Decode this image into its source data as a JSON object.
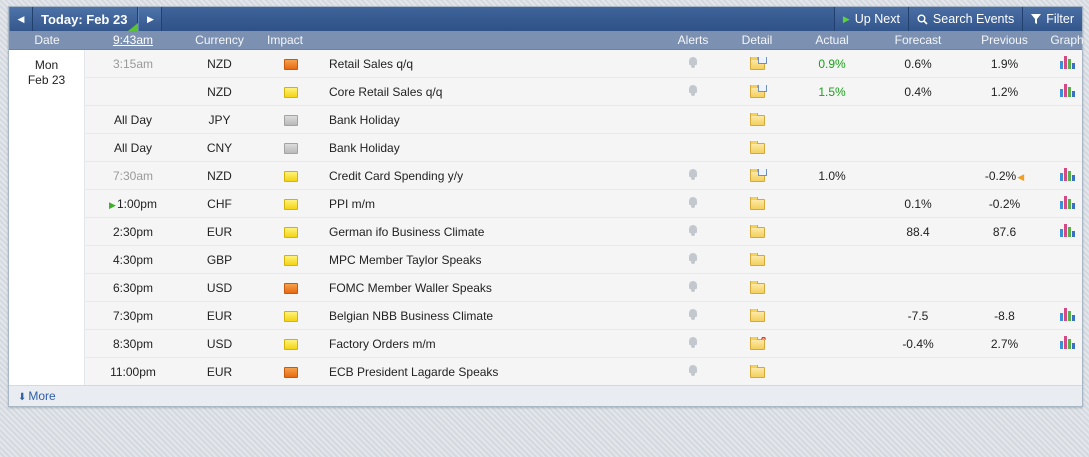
{
  "toolbar": {
    "prev_icon": "◀",
    "next_icon": "▶",
    "today_label": "Today: Feb 23",
    "up_next_label": "Up Next",
    "search_label": "Search Events",
    "filter_label": "Filter"
  },
  "headers": {
    "date": "Date",
    "time": "9:43am",
    "currency": "Currency",
    "impact": "Impact",
    "alerts": "Alerts",
    "detail": "Detail",
    "actual": "Actual",
    "forecast": "Forecast",
    "previous": "Previous",
    "graph": "Graph"
  },
  "day": {
    "weekday": "Mon",
    "date": "Feb 23"
  },
  "colors": {
    "high_impact": "#e56a12",
    "medium_impact": "#f3d312",
    "holiday": "#b9b9b9",
    "better_actual": "#19a319"
  },
  "events": [
    {
      "time": "3:15am",
      "past": true,
      "currency": "NZD",
      "impact": "high",
      "event": "Retail Sales q/q",
      "alert": true,
      "detail": "doc",
      "actual": "0.9%",
      "actual_better": true,
      "forecast": "0.6%",
      "previous": "1.9%",
      "revised": false,
      "graph": true,
      "next": false
    },
    {
      "time": "",
      "past": true,
      "currency": "NZD",
      "impact": "medium",
      "event": "Core Retail Sales q/q",
      "alert": true,
      "detail": "doc",
      "actual": "1.5%",
      "actual_better": true,
      "forecast": "0.4%",
      "previous": "1.2%",
      "revised": false,
      "graph": true,
      "next": false
    },
    {
      "time": "All Day",
      "past": false,
      "currency": "JPY",
      "impact": "holiday",
      "event": "Bank Holiday",
      "alert": false,
      "detail": "folder",
      "actual": "",
      "actual_better": false,
      "forecast": "",
      "previous": "",
      "revised": false,
      "graph": false,
      "next": false
    },
    {
      "time": "All Day",
      "past": false,
      "currency": "CNY",
      "impact": "holiday",
      "event": "Bank Holiday",
      "alert": false,
      "detail": "folder",
      "actual": "",
      "actual_better": false,
      "forecast": "",
      "previous": "",
      "revised": false,
      "graph": false,
      "next": false
    },
    {
      "time": "7:30am",
      "past": true,
      "currency": "NZD",
      "impact": "medium",
      "event": "Credit Card Spending y/y",
      "alert": true,
      "detail": "doc",
      "actual": "1.0%",
      "actual_better": false,
      "forecast": "",
      "previous": "-0.2%",
      "revised": true,
      "graph": true,
      "next": false
    },
    {
      "time": "1:00pm",
      "past": false,
      "currency": "CHF",
      "impact": "medium",
      "event": "PPI m/m",
      "alert": true,
      "detail": "folder",
      "actual": "",
      "actual_better": false,
      "forecast": "0.1%",
      "previous": "-0.2%",
      "revised": false,
      "graph": true,
      "next": true
    },
    {
      "time": "2:30pm",
      "past": false,
      "currency": "EUR",
      "impact": "medium",
      "event": "German ifo Business Climate",
      "alert": true,
      "detail": "folder",
      "actual": "",
      "actual_better": false,
      "forecast": "88.4",
      "previous": "87.6",
      "revised": false,
      "graph": true,
      "next": false
    },
    {
      "time": "4:30pm",
      "past": false,
      "currency": "GBP",
      "impact": "medium",
      "event": "MPC Member Taylor Speaks",
      "alert": true,
      "detail": "folder",
      "actual": "",
      "actual_better": false,
      "forecast": "",
      "previous": "",
      "revised": false,
      "graph": false,
      "next": false
    },
    {
      "time": "6:30pm",
      "past": false,
      "currency": "USD",
      "impact": "high",
      "event": "FOMC Member Waller Speaks",
      "alert": true,
      "detail": "folder",
      "actual": "",
      "actual_better": false,
      "forecast": "",
      "previous": "",
      "revised": false,
      "graph": false,
      "next": false
    },
    {
      "time": "7:30pm",
      "past": false,
      "currency": "EUR",
      "impact": "medium",
      "event": "Belgian NBB Business Climate",
      "alert": true,
      "detail": "folder",
      "actual": "",
      "actual_better": false,
      "forecast": "-7.5",
      "previous": "-8.8",
      "revised": false,
      "graph": true,
      "next": false
    },
    {
      "time": "8:30pm",
      "past": false,
      "currency": "USD",
      "impact": "medium",
      "event": "Factory Orders m/m",
      "alert": true,
      "detail": "star",
      "actual": "",
      "actual_better": false,
      "forecast": "-0.4%",
      "previous": "2.7%",
      "revised": false,
      "graph": true,
      "next": false
    },
    {
      "time": "11:00pm",
      "past": false,
      "currency": "EUR",
      "impact": "high",
      "event": "ECB President Lagarde Speaks",
      "alert": true,
      "detail": "folder",
      "actual": "",
      "actual_better": false,
      "forecast": "",
      "previous": "",
      "revised": false,
      "graph": false,
      "next": false
    }
  ],
  "footer": {
    "more_label": "More"
  }
}
